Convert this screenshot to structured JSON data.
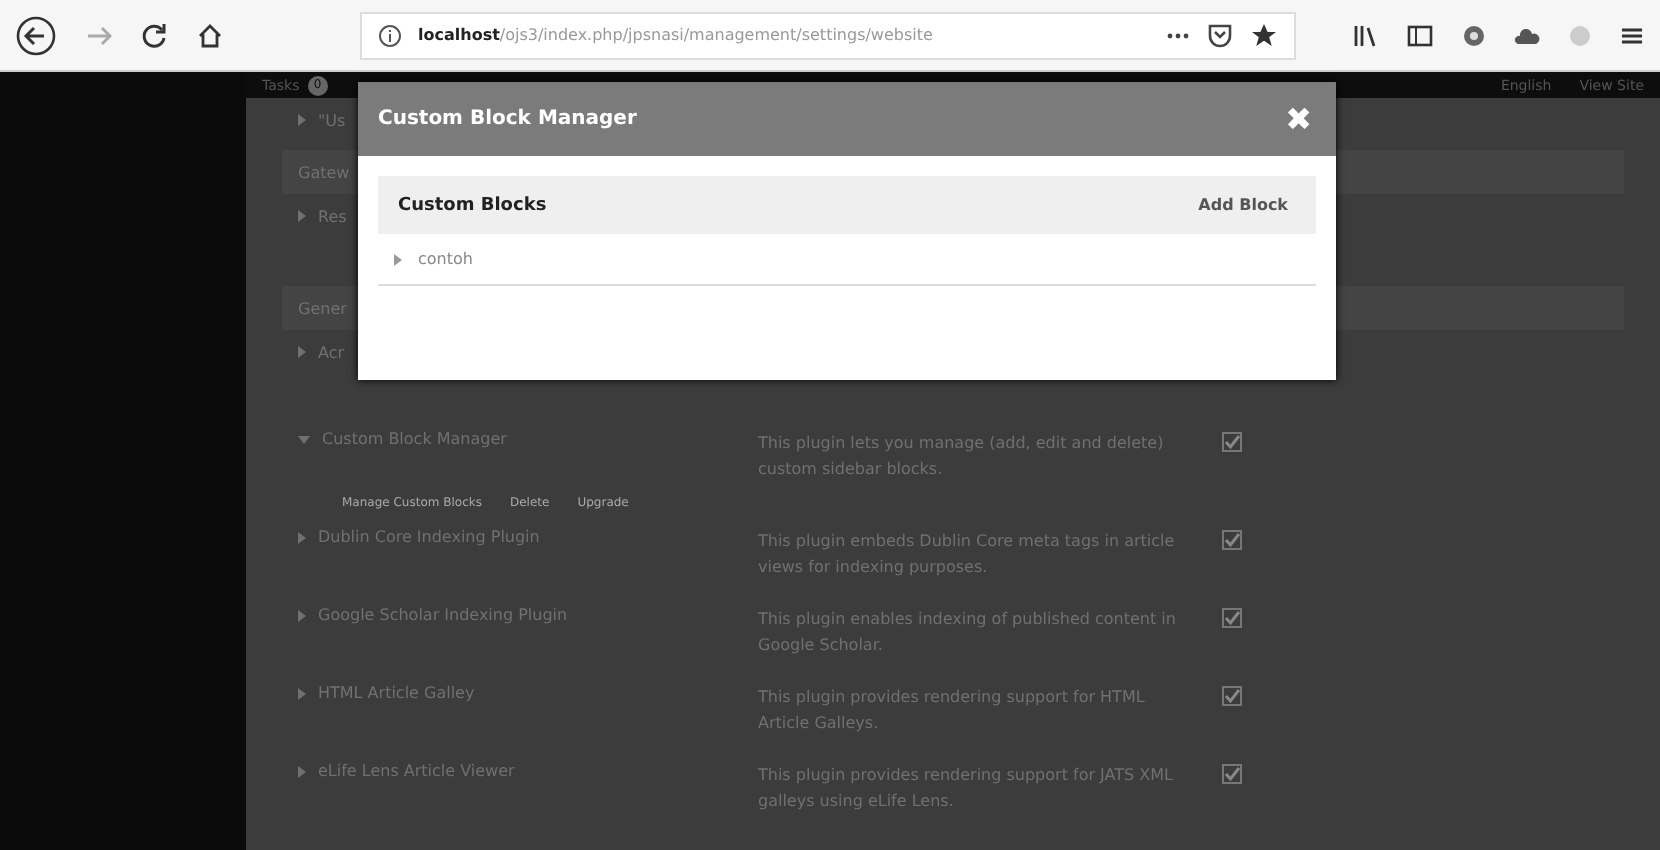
{
  "browser": {
    "url": "localhost/ojs3/index.php/jpsnasi/management/settings/website"
  },
  "topbar": {
    "tasks": "Tasks",
    "task_count": "0",
    "language": "English",
    "view_site": "View Site"
  },
  "hidden_rows": [
    {
      "kind": "item",
      "text": "\"Us"
    },
    {
      "kind": "heading",
      "text": "Gatew"
    },
    {
      "kind": "item",
      "text": "Res"
    },
    {
      "kind": "heading",
      "text": "Gener"
    },
    {
      "kind": "item",
      "text": "Acr"
    }
  ],
  "plugins": [
    {
      "name": "Custom Block Manager",
      "expanded": true,
      "description": "This plugin lets you manage (add, edit and delete) custom sidebar blocks.",
      "checked": true,
      "actions": [
        "Manage Custom Blocks",
        "Delete",
        "Upgrade"
      ]
    },
    {
      "name": "Dublin Core Indexing Plugin",
      "expanded": false,
      "description": "This plugin embeds Dublin Core meta tags in article views for indexing purposes.",
      "checked": true
    },
    {
      "name": "Google Scholar Indexing Plugin",
      "expanded": false,
      "description": "This plugin enables indexing of published content in Google Scholar.",
      "checked": true
    },
    {
      "name": "HTML Article Galley",
      "expanded": false,
      "description": "This plugin provides rendering support for HTML Article Galleys.",
      "checked": true
    },
    {
      "name": "eLife Lens Article Viewer",
      "expanded": false,
      "description": "This plugin provides rendering support for JATS XML galleys using eLife Lens.",
      "checked": true
    }
  ],
  "modal": {
    "title": "Custom Block Manager",
    "close": "✖",
    "section_title": "Custom Blocks",
    "add_button": "Add Block",
    "rows": [
      {
        "name": "contoh",
        "expanded": false
      }
    ]
  }
}
